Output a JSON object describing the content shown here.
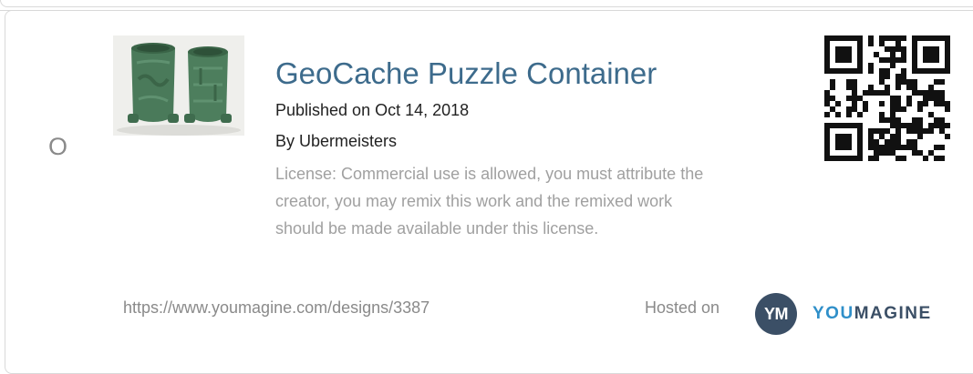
{
  "embed_icon_glyph": "O",
  "design": {
    "title": "GeoCache Puzzle Container",
    "published": "Published on Oct 14, 2018",
    "author": "By Ubermeisters",
    "license": "License: Commercial use is allowed, you must attribute the creator, you may remix this work and the remixed work should be made available under this license.",
    "url": "https://www.youmagine.com/designs/3387"
  },
  "footer": {
    "hosted_label": "Hosted on",
    "badge_text": "YM",
    "brand_part1": "YOU",
    "brand_part2": "MAGINE"
  },
  "icons": {
    "thumbnail": "green-printed-containers-photo",
    "qr": "qr-code-icon"
  },
  "colors": {
    "title": "#3d6b8c",
    "brand_blue": "#2f8fc9",
    "brand_dark": "#3b4f66",
    "muted": "#a0a0a0"
  }
}
